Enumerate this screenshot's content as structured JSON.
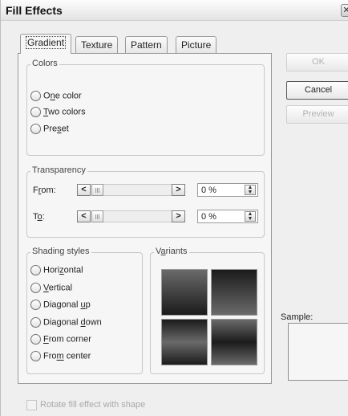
{
  "window": {
    "title": "Fill Effects",
    "close_glyph": "✕"
  },
  "tabs": [
    {
      "label": "Gradient",
      "active": true
    },
    {
      "label": "Texture",
      "active": false
    },
    {
      "label": "Pattern",
      "active": false
    },
    {
      "label": "Picture",
      "active": false
    }
  ],
  "colors_group": {
    "legend": "Colors",
    "options": [
      {
        "pre": "O",
        "ul": "n",
        "post": "e color"
      },
      {
        "pre": "",
        "ul": "T",
        "post": "wo colors"
      },
      {
        "pre": "Pre",
        "ul": "s",
        "post": "et"
      }
    ]
  },
  "transparency": {
    "legend": "Transparency",
    "from": {
      "pre": "F",
      "ul": "r",
      "post": "om:",
      "value": "0 %",
      "level_percent": 0
    },
    "to": {
      "pre": "T",
      "ul": "o",
      "post": ":",
      "value": "0 %",
      "level_percent": 0
    },
    "arrow_left": "<",
    "arrow_right": ">",
    "spin_up": "▲",
    "spin_down": "▼"
  },
  "shading": {
    "legend": "Shading styles",
    "options": [
      {
        "pre": "Hori",
        "ul": "z",
        "post": "ontal"
      },
      {
        "pre": "",
        "ul": "V",
        "post": "ertical"
      },
      {
        "pre": "Diagonal ",
        "ul": "u",
        "post": "p"
      },
      {
        "pre": "Diagonal ",
        "ul": "d",
        "post": "own"
      },
      {
        "pre": "",
        "ul": "F",
        "post": "rom corner"
      },
      {
        "pre": "Fro",
        "ul": "m",
        "post": " center"
      }
    ]
  },
  "variants": {
    "pre": "V",
    "ul": "a",
    "post": "riants"
  },
  "buttons": {
    "ok": "OK",
    "cancel": "Cancel",
    "preview": "Preview"
  },
  "sample_label": "Sample:",
  "rotate_checkbox": "Rotate fill effect with shape",
  "colors": {
    "dialog_bg": "#efefef",
    "panel_bg": "#f6f6f6",
    "swatch_dark": "#1b1b1b",
    "swatch_light": "#6a6a6a",
    "disabled_text": "#b3b3b3"
  }
}
